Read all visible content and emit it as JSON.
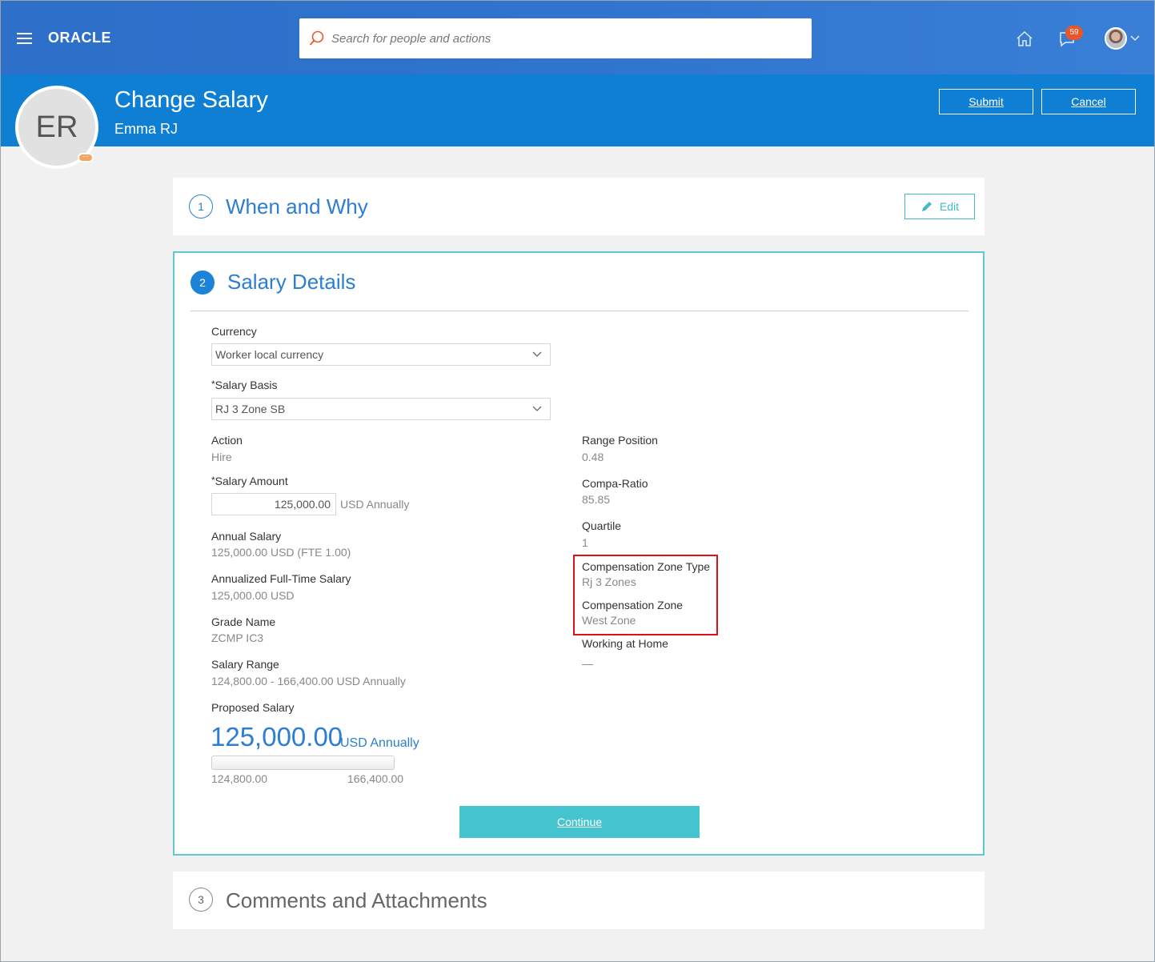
{
  "header": {
    "logo": "ORACLE",
    "search_placeholder": "Search for people and actions",
    "notification_count": "59"
  },
  "titleband": {
    "initials": "ER",
    "title": "Change Salary",
    "employee": "Emma RJ",
    "submit": "Submit",
    "cancel": "Cancel"
  },
  "sections": [
    {
      "number": "1",
      "title": "When and Why",
      "edit": "Edit"
    },
    {
      "number": "2",
      "title": "Salary Details"
    },
    {
      "number": "3",
      "title": "Comments and Attachments"
    }
  ],
  "salary": {
    "currency_label": "Currency",
    "currency_value": "Worker local currency",
    "basis_label": "Salary Basis",
    "basis_value": "RJ 3 Zone SB",
    "action_label": "Action",
    "action_value": "Hire",
    "amount_label": "Salary Amount",
    "amount_value": "125,000.00",
    "amount_unit": "USD Annually",
    "annual_label": "Annual Salary",
    "annual_value": "125,000.00 USD (FTE 1.00)",
    "annualized_label": "Annualized Full-Time Salary",
    "annualized_value": "125,000.00 USD",
    "grade_label": "Grade Name",
    "grade_value": "ZCMP IC3",
    "range_label": "Salary Range",
    "range_value": "124,800.00 - 166,400.00 USD Annually",
    "proposed_label": "Proposed Salary",
    "proposed_value": "125,000.00",
    "proposed_unit": "USD Annually",
    "range_min": "124,800.00",
    "range_max": "166,400.00",
    "range_position_fraction": 0.48,
    "range_position_label": "Range Position",
    "range_position_value": "0.48",
    "compa_label": "Compa-Ratio",
    "compa_value": "85.85",
    "quartile_label": "Quartile",
    "quartile_value": "1",
    "zone_type_label": "Compensation Zone Type",
    "zone_type_value": "Rj 3 Zones",
    "zone_label": "Compensation Zone",
    "zone_value": "West Zone",
    "home_label": "Working at Home",
    "home_value": "—",
    "continue": "Continue"
  },
  "colors": {
    "header_blue": "#2f74cf",
    "band_blue": "#0f7fd4",
    "accent_teal": "#44c4ce",
    "highlight_red": "#e0101a",
    "badge_orange": "#e8562a"
  }
}
